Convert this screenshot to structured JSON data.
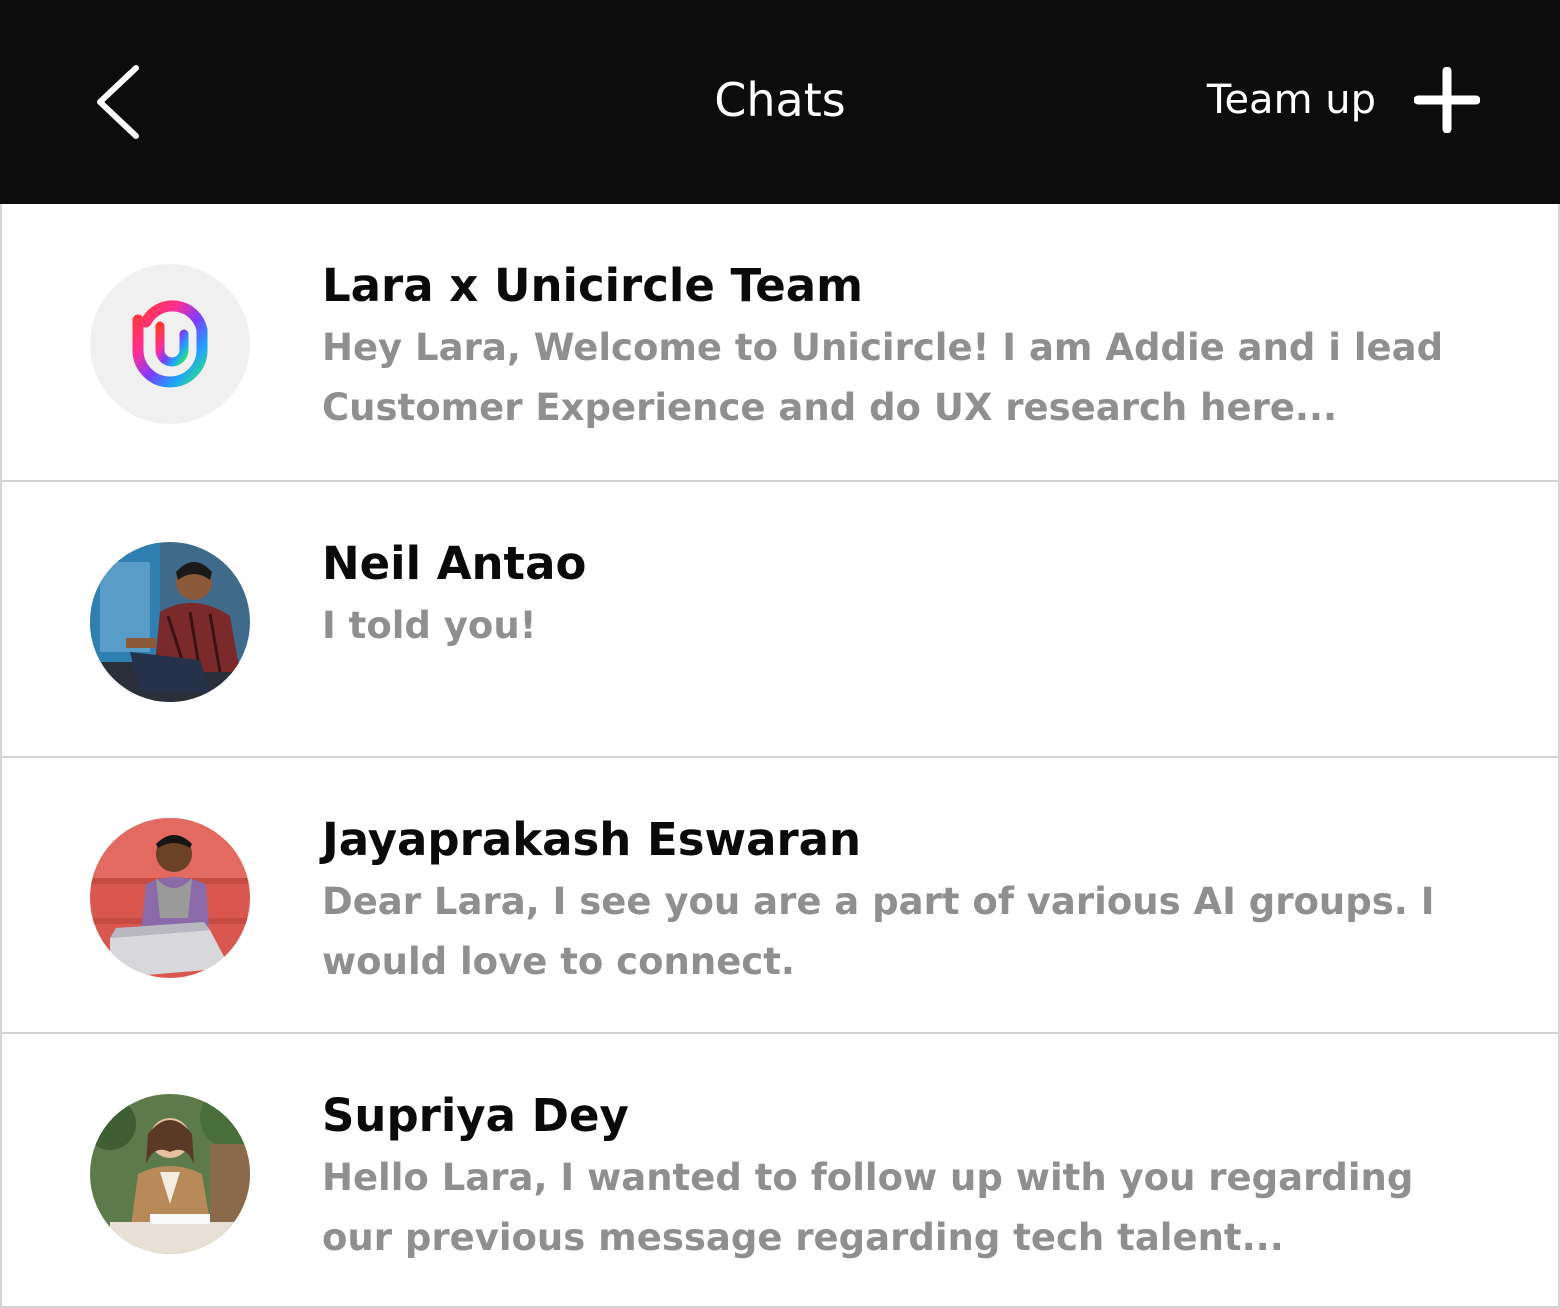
{
  "header": {
    "title": "Chats",
    "team_up_label": "Team up",
    "background_color": "#0c0c0c",
    "back_icon": "chevron-left-icon",
    "add_icon": "plus-icon"
  },
  "chats": [
    {
      "name": "Lara x Unicircle Team",
      "preview": "Hey Lara, Welcome to Unicircle! I am Addie and i lead Customer Experience and do UX research here...",
      "avatar": "unicircle-logo-icon"
    },
    {
      "name": "Neil Antao",
      "preview": "I told you!",
      "avatar": "user-photo-avatar"
    },
    {
      "name": "Jayaprakash Eswaran",
      "preview": "Dear Lara, I see you are a part of various AI groups. I would love to connect.",
      "avatar": "user-photo-avatar"
    },
    {
      "name": "Supriya Dey",
      "preview": "Hello Lara, I wanted to follow up with you regarding our previous message regarding tech talent...",
      "avatar": "user-photo-avatar"
    }
  ],
  "colors": {
    "name_text": "#0a0a0a",
    "preview_text": "#8f8f8f",
    "divider": "#d4d4d4"
  }
}
